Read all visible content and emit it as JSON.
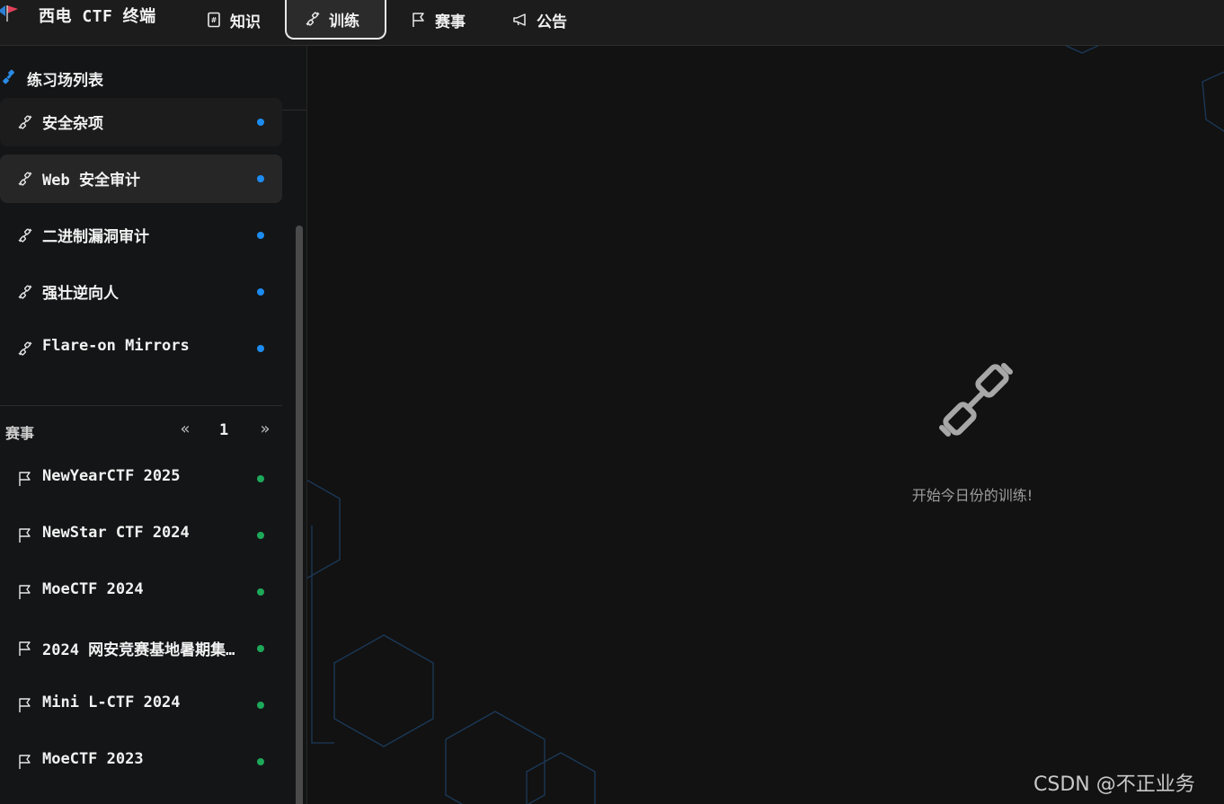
{
  "app": {
    "brand": "西电 CTF 终端",
    "nav": [
      {
        "label": "知识",
        "icon": "hash-book-icon"
      },
      {
        "label": "训练",
        "icon": "dumbbell-icon",
        "active": true
      },
      {
        "label": "赛事",
        "icon": "flag-icon"
      },
      {
        "label": "公告",
        "icon": "megaphone-icon"
      }
    ]
  },
  "sidebar": {
    "title": "练习场列表",
    "practice_items": [
      {
        "label": "安全杂项",
        "status_color": "#1d8cf0"
      },
      {
        "label": "Web 安全审计",
        "status_color": "#1d8cf0",
        "selected": true
      },
      {
        "label": "二进制漏洞审计",
        "status_color": "#1d8cf0"
      },
      {
        "label": "强壮逆向人",
        "status_color": "#1d8cf0"
      },
      {
        "label": "Flare-on Mirrors",
        "status_color": "#1d8cf0"
      }
    ],
    "contests": {
      "title": "赛事",
      "page": "1",
      "items": [
        {
          "label": "NewYearCTF 2025",
          "status_color": "#1ea85a"
        },
        {
          "label": "NewStar CTF 2024",
          "status_color": "#1ea85a"
        },
        {
          "label": "MoeCTF 2024",
          "status_color": "#1ea85a"
        },
        {
          "label": "2024 网安竞赛基地暑期集…",
          "status_color": "#1ea85a"
        },
        {
          "label": "Mini L-CTF 2024",
          "status_color": "#1ea85a"
        },
        {
          "label": "MoeCTF 2023",
          "status_color": "#1ea85a"
        }
      ]
    }
  },
  "main": {
    "empty_icon": "dumbbell-icon",
    "empty_text": "开始今日份的训练!"
  },
  "watermark": "CSDN @不正业务",
  "colors": {
    "accent_blue": "#1d8cf0",
    "status_green": "#1ea85a",
    "background": "#121212"
  }
}
